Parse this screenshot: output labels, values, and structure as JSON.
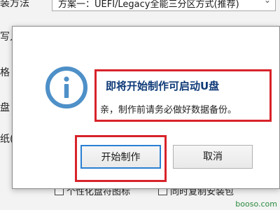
{
  "background": {
    "partial_labels": [
      "写入",
      "格",
      "盘",
      "纸(可"
    ],
    "top_label": "装方法",
    "top_select_value": "方案一：UEFI/Legacy全能三分区方式(推荐)",
    "bottom_checks": [
      "个性化盘符图标",
      "同时复制安装包"
    ]
  },
  "dialog": {
    "icon": "info-icon",
    "title": "即将开始制作可启动U盘",
    "message": "亲，制作前请务必做好数据备份。",
    "primary_button": "开始制作",
    "cancel_button": "取消"
  },
  "colors": {
    "highlight": "#d8232a",
    "title": "#0f3a78",
    "icon_blue": "#4e90c8",
    "primary_border": "#2a7fd4"
  },
  "watermark": "booso.com"
}
